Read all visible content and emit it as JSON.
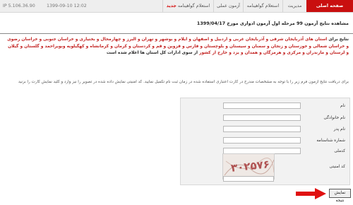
{
  "topbar": {
    "ip": "IP 5.106.36.90",
    "datetime": "1399-09-10 12:02",
    "tabs": [
      {
        "label": "صفحه اصلی"
      },
      {
        "label": "مدیریت"
      },
      {
        "label": "استعلام گواهینامه"
      },
      {
        "label": "آزمون عملی"
      },
      {
        "label": "استعلام گواهینامه",
        "badge": "جدید"
      }
    ]
  },
  "page": {
    "heading": "مشاهده نتایج آزمون 99 مرحله اول آزمون ادواری مورخ 1399/04/17",
    "notice_prefix": "نتایج برای",
    "notice_provinces": "استان های آذربایجان شرقی و آذربایجان غربی و اردبیل و اصفهان و ایلام و بوشهر و تهران و البرز و چهارمحال و بختیاری و خراسان جنوبی و خراسان رضوی و خراسان شمالی و خوزستان و زنجان و سمنان و سیستان و بلوچستان و فارس و قزوین و قم و کردستان و کرمان و کرمانشاه و کهگیلویه",
    "notice_more": "وبویراحمد و گلستان و گیلان و لرستان و مازندران و مرکزی و هرمزگان و همدان و یزد و خارج از کشور",
    "notice_suffix": "از سوی ادارات کل استان ها اعلام شده است",
    "instruction": "برای دریافت نتایج آزمون فرم زیر را با توجه به مشخصات مندرج در کارت اعتباری استفاده شده در زمان ثبت نام تکمیل نمایید. کد امنیتی نمایش داده شده در تصویر را نیز وارد و کلید نمایش کارت را بزنید"
  },
  "form": {
    "fields": [
      {
        "label": "نام",
        "value": ""
      },
      {
        "label": "نام خانوادگی",
        "value": ""
      },
      {
        "label": "نام پدر",
        "value": ""
      },
      {
        "label": "شماره شناسنامه",
        "value": ""
      },
      {
        "label": "کدملی",
        "value": ""
      }
    ],
    "captcha_label": "کد امنیتی",
    "captcha_text": "۳۰۲۵۷۶",
    "captcha_value": "",
    "submit_label": "نمایش نتیجه"
  },
  "colors": {
    "accent": "#c90f0f",
    "arrow": "#e01010"
  }
}
